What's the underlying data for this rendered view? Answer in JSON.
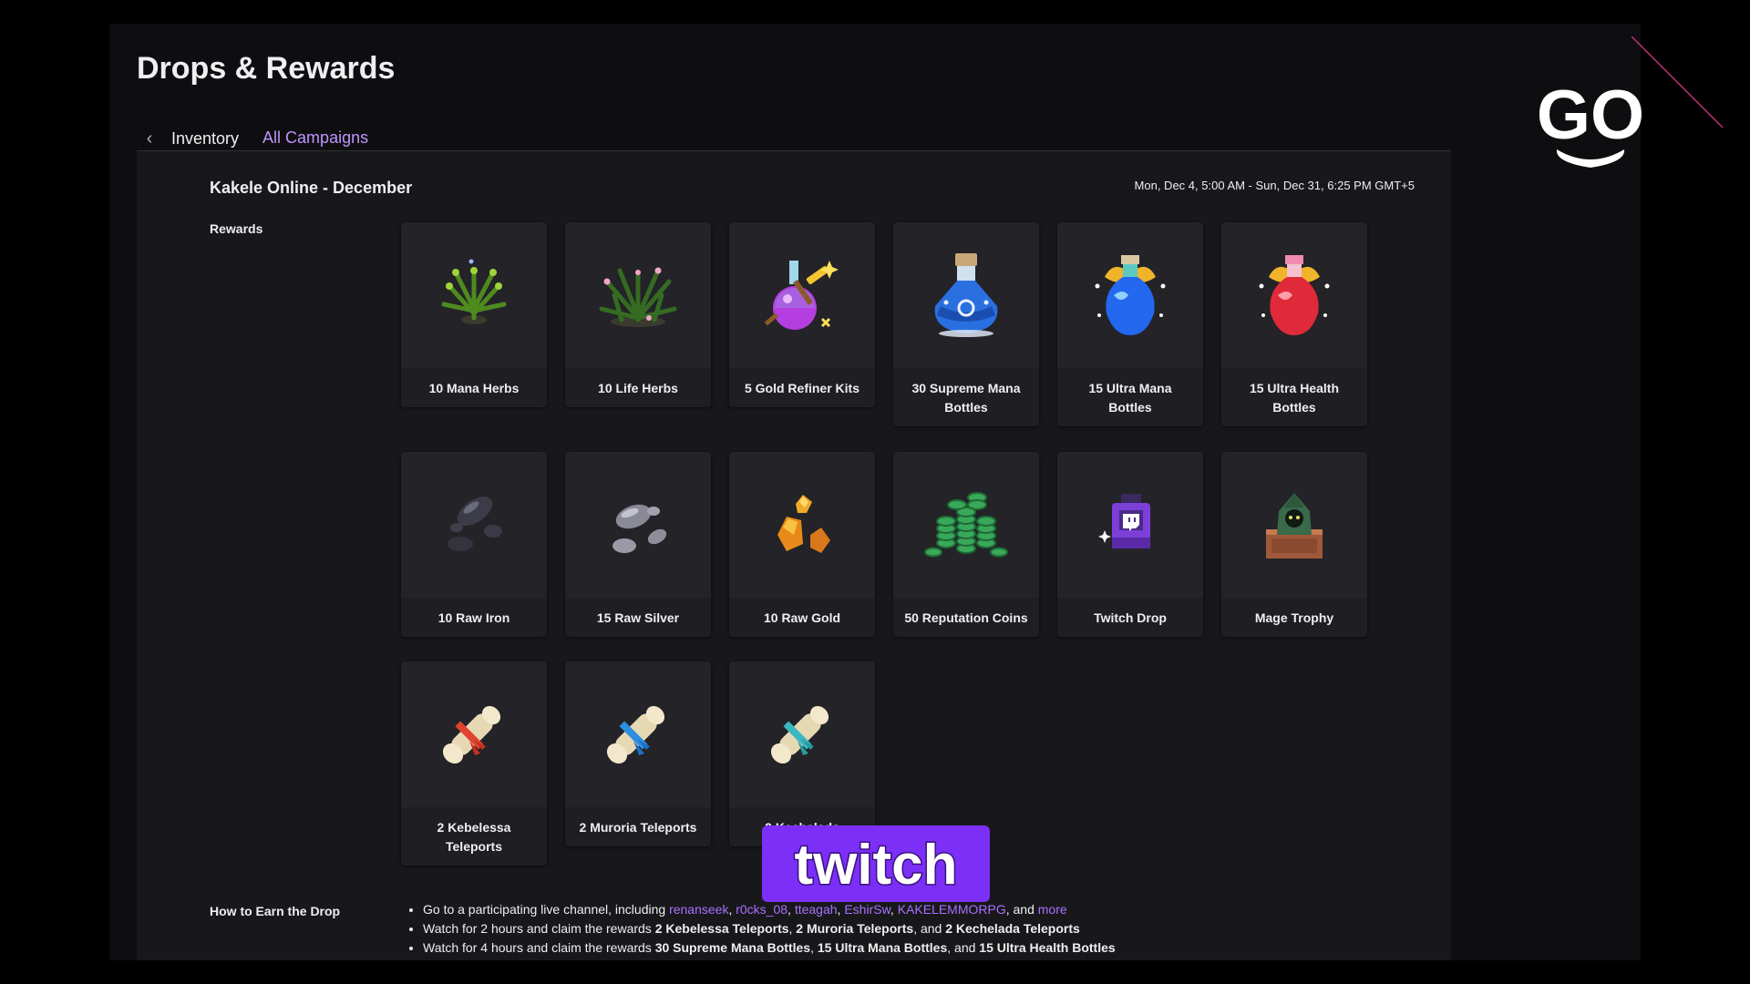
{
  "page": {
    "title": "Drops & Rewards",
    "tabs": [
      {
        "label": "Inventory",
        "active": false
      },
      {
        "label": "All Campaigns",
        "active": true
      }
    ],
    "accent_color": "#a970ff"
  },
  "campaign": {
    "name": "Kakele Online - December",
    "dates": "Mon, Dec 4, 5:00 AM - Sun, Dec 31, 6:25 PM GMT+5",
    "rewards_label": "Rewards",
    "rewards": [
      {
        "label": "10 Mana Herbs",
        "icon": "mana-herb-icon"
      },
      {
        "label": "10 Life Herbs",
        "icon": "life-herb-icon"
      },
      {
        "label": "5 Gold Refiner Kits",
        "icon": "gold-refiner-kit-icon"
      },
      {
        "label": "30 Supreme Mana Bottles",
        "icon": "supreme-mana-bottle-icon"
      },
      {
        "label": "15 Ultra Mana Bottles",
        "icon": "ultra-mana-bottle-icon"
      },
      {
        "label": "15 Ultra Health Bottles",
        "icon": "ultra-health-bottle-icon"
      },
      {
        "label": "10 Raw Iron",
        "icon": "raw-iron-icon"
      },
      {
        "label": "15 Raw Silver",
        "icon": "raw-silver-icon"
      },
      {
        "label": "10 Raw Gold",
        "icon": "raw-gold-icon"
      },
      {
        "label": "50 Reputation Coins",
        "icon": "reputation-coins-icon"
      },
      {
        "label": "Twitch Drop",
        "icon": "twitch-drop-icon"
      },
      {
        "label": "Mage Trophy",
        "icon": "mage-trophy-icon"
      },
      {
        "label": "2 Kebelessa Teleports",
        "icon": "kebelessa-teleport-scroll-icon"
      },
      {
        "label": "2 Muroria Teleports",
        "icon": "muroria-teleport-scroll-icon"
      },
      {
        "label": "2 Kechelada",
        "icon": "kechelada-teleport-scroll-icon"
      }
    ],
    "how_to_earn": {
      "label": "How to Earn the Drop",
      "line1_prefix": "Go to a participating live channel, including ",
      "channels": [
        "renanseek",
        "r0cks_08",
        "tteagah",
        "EshirSw",
        "KAKELEMMORPG"
      ],
      "line1_and": ", and ",
      "more_link": "more",
      "line2_prefix": "Watch for 2 hours and claim the rewards ",
      "line2_items": [
        "2 Kebelessa Teleports",
        "2 Muroria Teleports",
        "2 Kechelada Teleports"
      ],
      "line3_prefix": "Watch for 4 hours and claim the rewards ",
      "line3_items": [
        "30 Supreme Mana Bottles",
        "15 Ultra Mana Bottles",
        "15 Ultra Health Bottles"
      ],
      "comma": ", ",
      "and_joiner": ", and "
    }
  },
  "overlays": {
    "twitch_logo_text": "twitch",
    "go_logo_text": "GO"
  }
}
